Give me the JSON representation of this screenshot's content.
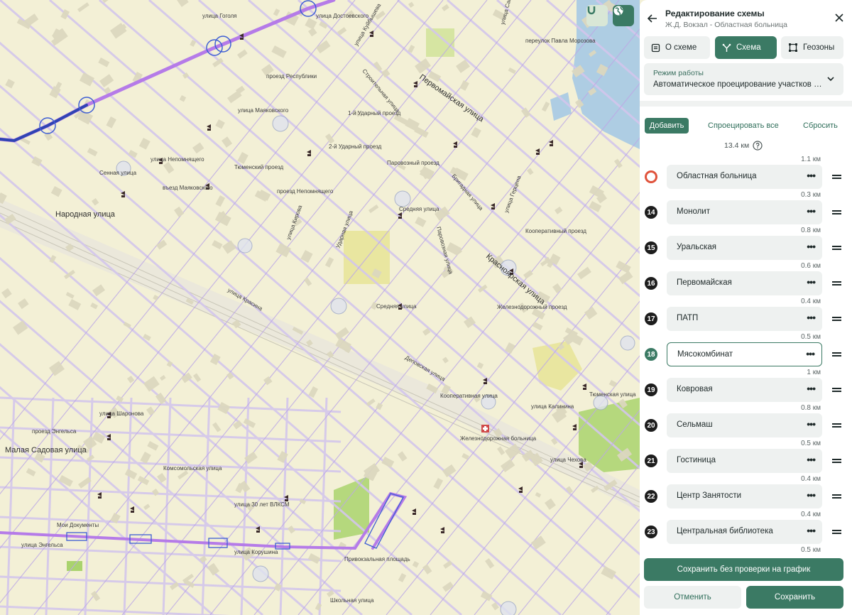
{
  "map": {
    "streets": [
      "улица Гоголя",
      "улица Достоевского",
      "улица Куйбышева",
      "Строительная улица",
      "Первомайская улица",
      "улица Маяковского",
      "проезд Республики",
      "1-й Ударный проезд",
      "2-й Ударный проезд",
      "улица Непомнящего",
      "Тюменский проезд",
      "въезд Маяковского",
      "проезд Непомнящего",
      "Паровозный проезд",
      "Бригадная улица",
      "улица Герцена",
      "улица Кирова",
      "Ударная улица",
      "Средняя улица",
      "Паровозная улица",
      "Красноярская улица",
      "улица Красина",
      "Сенная улица",
      "Народная улица",
      "Деповская улица",
      "Кооперативная улица",
      "Железнодорожная больница",
      "улица Калинина",
      "Тюменская улица",
      "улица Шаронова",
      "проезд Энгельса",
      "Малая Садовая улица",
      "Комсомольская улица",
      "улица 30 лет ВЛКСМ",
      "улица Энгельса",
      "улица Корушина",
      "Привокзальная площадь",
      "улица Чехова",
      "Школьная улица",
      "переулок Павла Морозова",
      "улица Сакко и Ванцетти",
      "Кооперативный проезд",
      "Железнодорожный проезд",
      "Средняя улица",
      "Мои Документы"
    ],
    "magnet_icon": "magnet-icon",
    "globe_icon": "globe-icon"
  },
  "header": {
    "title": "Редактирование схемы",
    "subtitle": "Ж.Д. Вокзал - Областная больница"
  },
  "tabs": [
    {
      "label": "О схеме",
      "icon": "document-icon",
      "active": false
    },
    {
      "label": "Схема",
      "icon": "route-icon",
      "active": true
    },
    {
      "label": "Геозоны",
      "icon": "polygon-icon",
      "active": false
    }
  ],
  "mode": {
    "label": "Режим работы",
    "value": "Автоматическое проецирование участков на граф"
  },
  "actions": {
    "add": "Добавить",
    "project_all": "Спроецировать все",
    "reset": "Сбросить",
    "total": "13.4 км"
  },
  "stops": {
    "top_distance": "1.1 км",
    "items": [
      {
        "num": "",
        "name": "Областная больница",
        "dist_after": "0.3 км",
        "terminal": true
      },
      {
        "num": "14",
        "name": "Монолит",
        "dist_after": "0.8 км"
      },
      {
        "num": "15",
        "name": "Уральская",
        "dist_after": "0.6 км"
      },
      {
        "num": "16",
        "name": "Первомайская",
        "dist_after": "0.4 км"
      },
      {
        "num": "17",
        "name": "ПАТП",
        "dist_after": "0.5 км"
      },
      {
        "num": "18",
        "name": "Мясокомбинат",
        "dist_after": "1 км",
        "current": true
      },
      {
        "num": "19",
        "name": "Ковровая",
        "dist_after": "0.8 км"
      },
      {
        "num": "20",
        "name": "Сельмаш",
        "dist_after": "0.5 км"
      },
      {
        "num": "21",
        "name": "Гостиница",
        "dist_after": "0.4 км"
      },
      {
        "num": "22",
        "name": "Центр Занятости",
        "dist_after": "0.4 км"
      },
      {
        "num": "23",
        "name": "Центральная библиотека",
        "dist_after": "0.5 км"
      }
    ]
  },
  "footer": {
    "save_no_check": "Сохранить без проверки на график",
    "cancel": "Отменить",
    "save": "Сохранить"
  },
  "colors": {
    "accent": "#3b7a64",
    "route_purple": "#b57be8",
    "route_blue": "#2f44b3",
    "terminal_ring": "#e0533c",
    "map_bg": "#f3f0d6"
  }
}
